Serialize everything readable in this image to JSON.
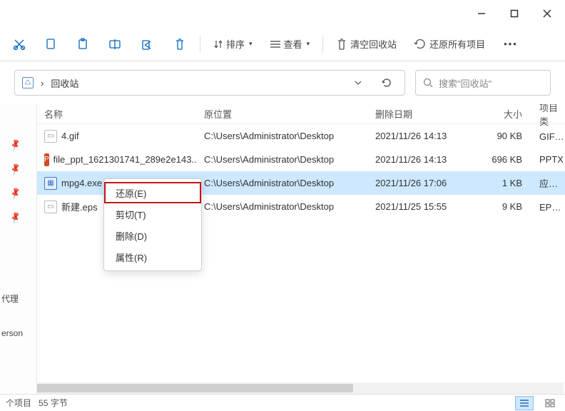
{
  "window_controls": {
    "min": "—",
    "max": "▢",
    "close": "✕"
  },
  "toolbar": {
    "sort_label": "排序",
    "view_label": "查看",
    "empty_label": "清空回收站",
    "restore_all_label": "还原所有项目"
  },
  "address": {
    "location": "回收站",
    "chevron": "›"
  },
  "search": {
    "placeholder": "搜索\"回收站\""
  },
  "sidebar": {
    "label_proxy": "代理",
    "label_erson": "erson"
  },
  "columns": {
    "name": "名称",
    "location": "原位置",
    "date": "删除日期",
    "size": "大小",
    "type": "项目类"
  },
  "rows": [
    {
      "icon": "gif",
      "name": "4.gif",
      "loc": "C:\\Users\\Administrator\\Desktop",
      "date": "2021/11/26 14:13",
      "size": "90 KB",
      "type": "GIF 文",
      "selected": false
    },
    {
      "icon": "ppt",
      "name": "file_ppt_1621301741_289e2e143...",
      "loc": "C:\\Users\\Administrator\\Desktop",
      "date": "2021/11/26 14:13",
      "size": "696 KB",
      "type": "PPTX",
      "selected": false
    },
    {
      "icon": "exe",
      "name": "mpg4.exe",
      "loc": "C:\\Users\\Administrator\\Desktop",
      "date": "2021/11/26 17:06",
      "size": "1 KB",
      "type": "应用程",
      "selected": true
    },
    {
      "icon": "eps",
      "name": "新建.eps",
      "loc": "C:\\Users\\Administrator\\Desktop",
      "date": "2021/11/25 15:55",
      "size": "9 KB",
      "type": "EPS 文",
      "selected": false
    }
  ],
  "context_menu": {
    "restore": "还原(E)",
    "cut": "剪切(T)",
    "delete": "删除(D)",
    "properties": "属性(R)"
  },
  "status": {
    "items": "个项目",
    "size": "55 字节"
  }
}
